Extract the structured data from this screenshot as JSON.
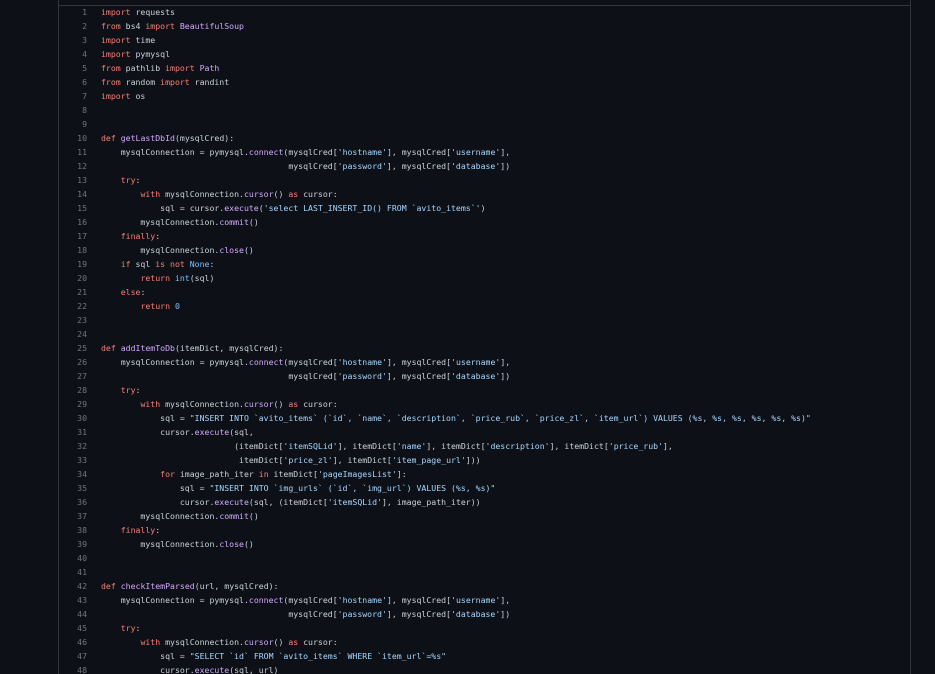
{
  "lines": [
    [
      {
        "t": "import",
        "c": "kw"
      },
      {
        "t": " requests",
        "c": "pl"
      }
    ],
    [
      {
        "t": "from",
        "c": "kw"
      },
      {
        "t": " bs4 ",
        "c": "pl"
      },
      {
        "t": "import",
        "c": "kw"
      },
      {
        "t": " BeautifulSoup",
        "c": "fn"
      }
    ],
    [
      {
        "t": "import",
        "c": "kw"
      },
      {
        "t": " time",
        "c": "pl"
      }
    ],
    [
      {
        "t": "import",
        "c": "kw"
      },
      {
        "t": " pymysql",
        "c": "pl"
      }
    ],
    [
      {
        "t": "from",
        "c": "kw"
      },
      {
        "t": " pathlib ",
        "c": "pl"
      },
      {
        "t": "import",
        "c": "kw"
      },
      {
        "t": " Path",
        "c": "fn"
      }
    ],
    [
      {
        "t": "from",
        "c": "kw"
      },
      {
        "t": " random ",
        "c": "pl"
      },
      {
        "t": "import",
        "c": "kw"
      },
      {
        "t": " randint",
        "c": "pl"
      }
    ],
    [
      {
        "t": "import",
        "c": "kw"
      },
      {
        "t": " os",
        "c": "pl"
      }
    ],
    [],
    [],
    [
      {
        "t": "def",
        "c": "kw"
      },
      {
        "t": " ",
        "c": "pl"
      },
      {
        "t": "getLastDbId",
        "c": "fn"
      },
      {
        "t": "(mysqlCred):",
        "c": "pl"
      }
    ],
    [
      {
        "t": "    mysqlConnection = pymysql.",
        "c": "pl"
      },
      {
        "t": "connect",
        "c": "fn"
      },
      {
        "t": "(mysqlCred[",
        "c": "pl"
      },
      {
        "t": "'hostname'",
        "c": "str"
      },
      {
        "t": "], mysqlCred[",
        "c": "pl"
      },
      {
        "t": "'username'",
        "c": "str"
      },
      {
        "t": "],",
        "c": "pl"
      }
    ],
    [
      {
        "t": "                                      mysqlCred[",
        "c": "pl"
      },
      {
        "t": "'password'",
        "c": "str"
      },
      {
        "t": "], mysqlCred[",
        "c": "pl"
      },
      {
        "t": "'database'",
        "c": "str"
      },
      {
        "t": "])",
        "c": "pl"
      }
    ],
    [
      {
        "t": "    ",
        "c": "pl"
      },
      {
        "t": "try",
        "c": "kw"
      },
      {
        "t": ":",
        "c": "pl"
      }
    ],
    [
      {
        "t": "        ",
        "c": "pl"
      },
      {
        "t": "with",
        "c": "kw"
      },
      {
        "t": " mysqlConnection.",
        "c": "pl"
      },
      {
        "t": "cursor",
        "c": "fn"
      },
      {
        "t": "() ",
        "c": "pl"
      },
      {
        "t": "as",
        "c": "kw"
      },
      {
        "t": " cursor:",
        "c": "pl"
      }
    ],
    [
      {
        "t": "            sql = cursor.",
        "c": "pl"
      },
      {
        "t": "execute",
        "c": "fn"
      },
      {
        "t": "(",
        "c": "pl"
      },
      {
        "t": "'select LAST_INSERT_ID() FROM `avito_items`'",
        "c": "str"
      },
      {
        "t": ")",
        "c": "pl"
      }
    ],
    [
      {
        "t": "        mysqlConnection.",
        "c": "pl"
      },
      {
        "t": "commit",
        "c": "fn"
      },
      {
        "t": "()",
        "c": "pl"
      }
    ],
    [
      {
        "t": "    ",
        "c": "pl"
      },
      {
        "t": "finally",
        "c": "kw"
      },
      {
        "t": ":",
        "c": "pl"
      }
    ],
    [
      {
        "t": "        mysqlConnection.",
        "c": "pl"
      },
      {
        "t": "close",
        "c": "fn"
      },
      {
        "t": "()",
        "c": "pl"
      }
    ],
    [
      {
        "t": "    ",
        "c": "pl"
      },
      {
        "t": "if",
        "c": "kw"
      },
      {
        "t": " sql ",
        "c": "pl"
      },
      {
        "t": "is not",
        "c": "kw"
      },
      {
        "t": " ",
        "c": "pl"
      },
      {
        "t": "None",
        "c": "bi"
      },
      {
        "t": ":",
        "c": "pl"
      }
    ],
    [
      {
        "t": "        ",
        "c": "pl"
      },
      {
        "t": "return",
        "c": "kw"
      },
      {
        "t": " ",
        "c": "pl"
      },
      {
        "t": "int",
        "c": "bi"
      },
      {
        "t": "(sql)",
        "c": "pl"
      }
    ],
    [
      {
        "t": "    ",
        "c": "pl"
      },
      {
        "t": "else",
        "c": "kw"
      },
      {
        "t": ":",
        "c": "pl"
      }
    ],
    [
      {
        "t": "        ",
        "c": "pl"
      },
      {
        "t": "return",
        "c": "kw"
      },
      {
        "t": " ",
        "c": "pl"
      },
      {
        "t": "0",
        "c": "num"
      }
    ],
    [],
    [],
    [
      {
        "t": "def",
        "c": "kw"
      },
      {
        "t": " ",
        "c": "pl"
      },
      {
        "t": "addItemToDb",
        "c": "fn"
      },
      {
        "t": "(itemDict, mysqlCred):",
        "c": "pl"
      }
    ],
    [
      {
        "t": "    mysqlConnection = pymysql.",
        "c": "pl"
      },
      {
        "t": "connect",
        "c": "fn"
      },
      {
        "t": "(mysqlCred[",
        "c": "pl"
      },
      {
        "t": "'hostname'",
        "c": "str"
      },
      {
        "t": "], mysqlCred[",
        "c": "pl"
      },
      {
        "t": "'username'",
        "c": "str"
      },
      {
        "t": "],",
        "c": "pl"
      }
    ],
    [
      {
        "t": "                                      mysqlCred[",
        "c": "pl"
      },
      {
        "t": "'password'",
        "c": "str"
      },
      {
        "t": "], mysqlCred[",
        "c": "pl"
      },
      {
        "t": "'database'",
        "c": "str"
      },
      {
        "t": "])",
        "c": "pl"
      }
    ],
    [
      {
        "t": "    ",
        "c": "pl"
      },
      {
        "t": "try",
        "c": "kw"
      },
      {
        "t": ":",
        "c": "pl"
      }
    ],
    [
      {
        "t": "        ",
        "c": "pl"
      },
      {
        "t": "with",
        "c": "kw"
      },
      {
        "t": " mysqlConnection.",
        "c": "pl"
      },
      {
        "t": "cursor",
        "c": "fn"
      },
      {
        "t": "() ",
        "c": "pl"
      },
      {
        "t": "as",
        "c": "kw"
      },
      {
        "t": " cursor:",
        "c": "pl"
      }
    ],
    [
      {
        "t": "            sql = ",
        "c": "pl"
      },
      {
        "t": "\"INSERT INTO `avito_items` (`id`, `name`, `description`, `price_rub`, `price_zl`, `item_url`) VALUES (%s, %s, %s, %s, %s, %s)\"",
        "c": "str"
      }
    ],
    [
      {
        "t": "            cursor.",
        "c": "pl"
      },
      {
        "t": "execute",
        "c": "fn"
      },
      {
        "t": "(sql,",
        "c": "pl"
      }
    ],
    [
      {
        "t": "                           (itemDict[",
        "c": "pl"
      },
      {
        "t": "'itemSQLid'",
        "c": "str"
      },
      {
        "t": "], itemDict[",
        "c": "pl"
      },
      {
        "t": "'name'",
        "c": "str"
      },
      {
        "t": "], itemDict[",
        "c": "pl"
      },
      {
        "t": "'description'",
        "c": "str"
      },
      {
        "t": "], itemDict[",
        "c": "pl"
      },
      {
        "t": "'price_rub'",
        "c": "str"
      },
      {
        "t": "],",
        "c": "pl"
      }
    ],
    [
      {
        "t": "                            itemDict[",
        "c": "pl"
      },
      {
        "t": "'price_zl'",
        "c": "str"
      },
      {
        "t": "], itemDict[",
        "c": "pl"
      },
      {
        "t": "'item_page_url'",
        "c": "str"
      },
      {
        "t": "]))",
        "c": "pl"
      }
    ],
    [
      {
        "t": "            ",
        "c": "pl"
      },
      {
        "t": "for",
        "c": "kw"
      },
      {
        "t": " image_path_iter ",
        "c": "pl"
      },
      {
        "t": "in",
        "c": "kw"
      },
      {
        "t": " itemDict[",
        "c": "pl"
      },
      {
        "t": "'pageImagesList'",
        "c": "str"
      },
      {
        "t": "]:",
        "c": "pl"
      }
    ],
    [
      {
        "t": "                sql = ",
        "c": "pl"
      },
      {
        "t": "\"INSERT INTO `img_urls` (`id`, `img_url`) VALUES (%s, %s)\"",
        "c": "str"
      }
    ],
    [
      {
        "t": "                cursor.",
        "c": "pl"
      },
      {
        "t": "execute",
        "c": "fn"
      },
      {
        "t": "(sql, (itemDict[",
        "c": "pl"
      },
      {
        "t": "'itemSQLid'",
        "c": "str"
      },
      {
        "t": "], image_path_iter))",
        "c": "pl"
      }
    ],
    [
      {
        "t": "        mysqlConnection.",
        "c": "pl"
      },
      {
        "t": "commit",
        "c": "fn"
      },
      {
        "t": "()",
        "c": "pl"
      }
    ],
    [
      {
        "t": "    ",
        "c": "pl"
      },
      {
        "t": "finally",
        "c": "kw"
      },
      {
        "t": ":",
        "c": "pl"
      }
    ],
    [
      {
        "t": "        mysqlConnection.",
        "c": "pl"
      },
      {
        "t": "close",
        "c": "fn"
      },
      {
        "t": "()",
        "c": "pl"
      }
    ],
    [],
    [],
    [
      {
        "t": "def",
        "c": "kw"
      },
      {
        "t": " ",
        "c": "pl"
      },
      {
        "t": "checkItemParsed",
        "c": "fn"
      },
      {
        "t": "(url, mysqlCred):",
        "c": "pl"
      }
    ],
    [
      {
        "t": "    mysqlConnection = pymysql.",
        "c": "pl"
      },
      {
        "t": "connect",
        "c": "fn"
      },
      {
        "t": "(mysqlCred[",
        "c": "pl"
      },
      {
        "t": "'hostname'",
        "c": "str"
      },
      {
        "t": "], mysqlCred[",
        "c": "pl"
      },
      {
        "t": "'username'",
        "c": "str"
      },
      {
        "t": "],",
        "c": "pl"
      }
    ],
    [
      {
        "t": "                                      mysqlCred[",
        "c": "pl"
      },
      {
        "t": "'password'",
        "c": "str"
      },
      {
        "t": "], mysqlCred[",
        "c": "pl"
      },
      {
        "t": "'database'",
        "c": "str"
      },
      {
        "t": "])",
        "c": "pl"
      }
    ],
    [
      {
        "t": "    ",
        "c": "pl"
      },
      {
        "t": "try",
        "c": "kw"
      },
      {
        "t": ":",
        "c": "pl"
      }
    ],
    [
      {
        "t": "        ",
        "c": "pl"
      },
      {
        "t": "with",
        "c": "kw"
      },
      {
        "t": " mysqlConnection.",
        "c": "pl"
      },
      {
        "t": "cursor",
        "c": "fn"
      },
      {
        "t": "() ",
        "c": "pl"
      },
      {
        "t": "as",
        "c": "kw"
      },
      {
        "t": " cursor:",
        "c": "pl"
      }
    ],
    [
      {
        "t": "            sql = ",
        "c": "pl"
      },
      {
        "t": "\"SELECT `id` FROM `avito_items` WHERE `item_url`=%s\"",
        "c": "str"
      }
    ],
    [
      {
        "t": "            cursor.",
        "c": "pl"
      },
      {
        "t": "execute",
        "c": "fn"
      },
      {
        "t": "(sql, url)",
        "c": "pl"
      }
    ]
  ]
}
